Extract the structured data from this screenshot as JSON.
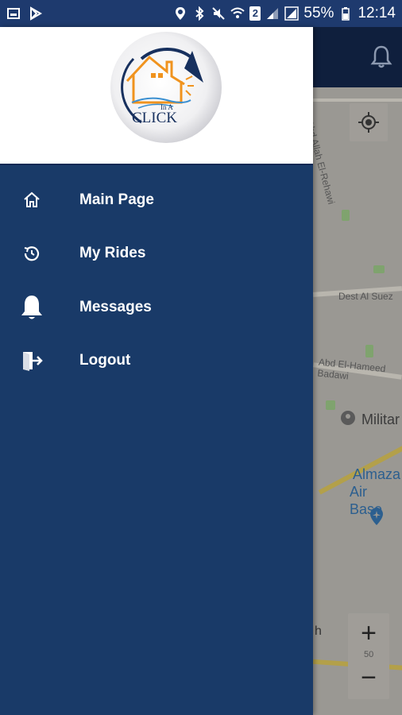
{
  "status_bar": {
    "battery_percent": "55%",
    "time": "12:14",
    "sim_badge": "2"
  },
  "map": {
    "labels": [
      "Abd Allah El-Rehawi",
      "Dest Al Suez",
      "Abd El-Hameed Badawi"
    ],
    "poi_military": "Militar",
    "poi_airbase_line1": "Almaza",
    "poi_airbase_line2": "Air Base",
    "road_number": "50",
    "partial_letter": "h"
  },
  "logo": {
    "line1": "In A",
    "line2": "CLICK"
  },
  "menu": [
    {
      "label": "Main Page",
      "icon": "home-icon"
    },
    {
      "label": "My Rides",
      "icon": "history-icon"
    },
    {
      "label": "Messages",
      "icon": "bell-icon"
    },
    {
      "label": "Logout",
      "icon": "logout-icon"
    }
  ],
  "colors": {
    "drawer": "#193a68",
    "status_bar": "#1e3a6e",
    "header": "#ffffff",
    "logo_orange": "#f0931e",
    "logo_navy": "#17305e"
  }
}
